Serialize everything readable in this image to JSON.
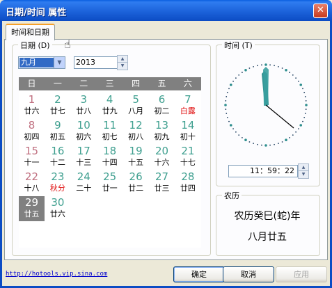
{
  "window": {
    "title": "日期/时间 属性",
    "close_label": "✕"
  },
  "tab": {
    "label": "时间和日期"
  },
  "date_group": {
    "title": "日期 (D)",
    "month": "九月",
    "year": "2013",
    "weekdays": [
      "日",
      "一",
      "二",
      "三",
      "四",
      "五",
      "六"
    ],
    "days": [
      {
        "d": "1",
        "l": "廿六"
      },
      {
        "d": "2",
        "l": "廿七"
      },
      {
        "d": "3",
        "l": "廿八"
      },
      {
        "d": "4",
        "l": "廿九"
      },
      {
        "d": "5",
        "l": "八月"
      },
      {
        "d": "6",
        "l": "初二"
      },
      {
        "d": "7",
        "l": "白露",
        "red": true
      },
      {
        "d": "8",
        "l": "初四"
      },
      {
        "d": "9",
        "l": "初五"
      },
      {
        "d": "10",
        "l": "初六"
      },
      {
        "d": "11",
        "l": "初七"
      },
      {
        "d": "12",
        "l": "初八"
      },
      {
        "d": "13",
        "l": "初九"
      },
      {
        "d": "14",
        "l": "初十"
      },
      {
        "d": "15",
        "l": "十一"
      },
      {
        "d": "16",
        "l": "十二"
      },
      {
        "d": "17",
        "l": "十三"
      },
      {
        "d": "18",
        "l": "十四"
      },
      {
        "d": "19",
        "l": "十五"
      },
      {
        "d": "20",
        "l": "十六"
      },
      {
        "d": "21",
        "l": "十七"
      },
      {
        "d": "22",
        "l": "十八"
      },
      {
        "d": "23",
        "l": "秋分",
        "red": true
      },
      {
        "d": "24",
        "l": "二十"
      },
      {
        "d": "25",
        "l": "廿一"
      },
      {
        "d": "26",
        "l": "廿二"
      },
      {
        "d": "27",
        "l": "廿三"
      },
      {
        "d": "28",
        "l": "廿四"
      },
      {
        "d": "29",
        "l": "廿五",
        "selected": true
      },
      {
        "d": "30",
        "l": "廿六"
      }
    ]
  },
  "time_group": {
    "title": "时间 (T)",
    "time": "11：59：22"
  },
  "lunar_group": {
    "title": "农历",
    "year": "农历癸巳(蛇)年",
    "date": "八月廿五"
  },
  "footer": {
    "link": "http://hotools.vip.sina.com",
    "ok": "确定",
    "cancel": "取消",
    "apply": "应用"
  },
  "colors": {
    "title_bar": "#1a60d8",
    "selected_day": "#808080",
    "holiday_red": "#e01010"
  }
}
